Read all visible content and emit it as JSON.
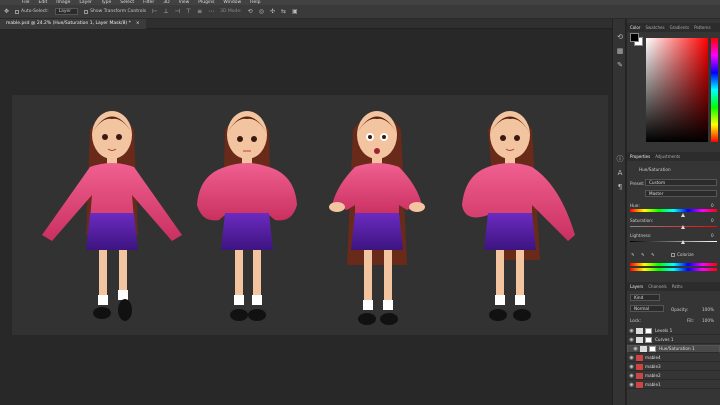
{
  "menu": [
    "File",
    "Edit",
    "Image",
    "Layer",
    "Type",
    "Select",
    "Filter",
    "3D",
    "View",
    "Plugins",
    "Window",
    "Help"
  ],
  "options": {
    "auto_select": "Auto-Select:",
    "layer_select": "Layer",
    "transform": "Show Transform Controls",
    "mode_3d": "3D Mode:"
  },
  "document": {
    "tab_title": "mable.psd @ 24.2% (Hue/Saturation 1, Layer Mask/8) *",
    "close": "×"
  },
  "color_panel": {
    "tabs": [
      "Color",
      "Swatches",
      "Gradients",
      "Patterns"
    ],
    "fg": "#000000",
    "bg": "#ffffff"
  },
  "properties": {
    "tabs": [
      "Properties",
      "Adjustments"
    ],
    "title": "Hue/Saturation",
    "preset_label": "Preset:",
    "preset_value": "Custom",
    "channel_value": "Master",
    "hue_label": "Hue:",
    "hue_value": "0",
    "sat_label": "Saturation:",
    "sat_value": "0",
    "light_label": "Lightness:",
    "light_value": "0",
    "colorize_label": "Colorize"
  },
  "layers": {
    "tabs": [
      "Layers",
      "Channels",
      "Paths"
    ],
    "kind": "Kind",
    "blend": "Normal",
    "opacity_label": "Opacity:",
    "opacity_value": "100%",
    "lock_label": "Lock:",
    "fill_label": "Fill:",
    "fill_value": "100%",
    "items": [
      {
        "name": "Levels 1"
      },
      {
        "name": "Curves 1"
      },
      {
        "name": "Hue/Saturation 1"
      },
      {
        "name": "mable4"
      },
      {
        "name": "mable3"
      },
      {
        "name": "mable2"
      },
      {
        "name": "mable1"
      }
    ]
  },
  "colors": {
    "pink": "#e0456f",
    "skirt": "#5a1fa8",
    "hair": "#6a2a1a",
    "skin": "#f2c4a0"
  }
}
